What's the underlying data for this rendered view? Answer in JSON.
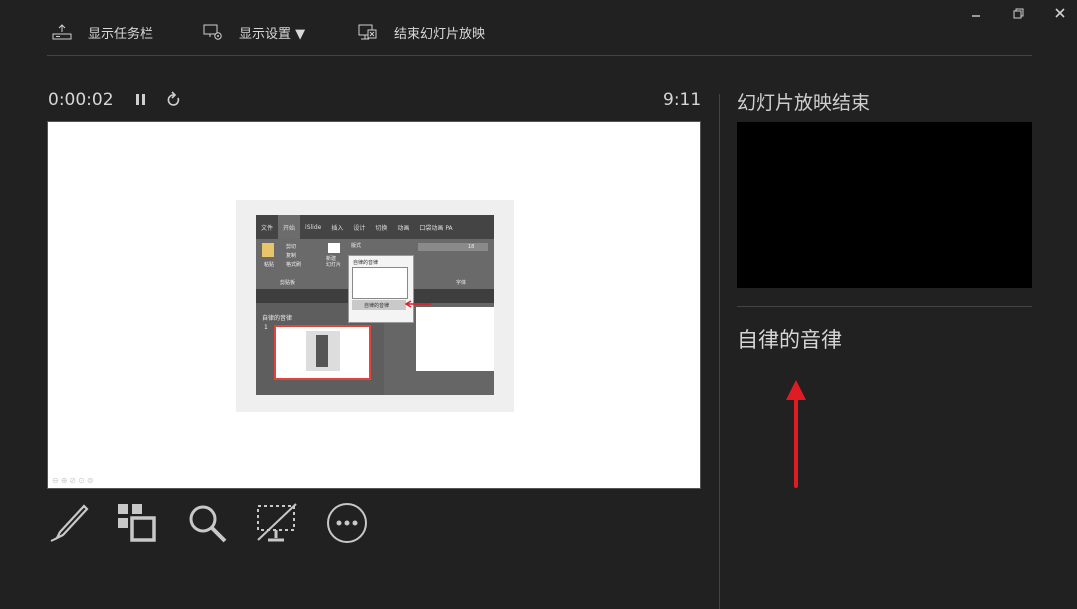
{
  "window": {
    "minimize_icon": "minimize-icon",
    "restore_icon": "restore-icon",
    "close_icon": "close-icon"
  },
  "toolbar": {
    "show_taskbar": "显示任务栏",
    "display_settings": "显示设置 ▼",
    "end_slideshow": "结束幻灯片放映"
  },
  "presenter": {
    "elapsed_time": "0:00:02",
    "clock": "9:11",
    "pause_icon": "pause-icon",
    "restart_icon": "restart-icon"
  },
  "current_slide": {
    "ribbon_tabs": [
      "文件",
      "开始",
      "iSlide",
      "插入",
      "设计",
      "切换",
      "动画",
      "口袋动画 PA"
    ],
    "active_tab_index": 1,
    "ribbon_labels": {
      "paste": "粘贴",
      "cut": "剪切",
      "copy": "复制",
      "format_painter": "格式刷",
      "new_slide": "新建\n幻灯片",
      "layout": "版式",
      "clipboard_group": "剪贴板",
      "font_group": "字体",
      "font_size": "18"
    },
    "section_label": "自律的音律",
    "slide_number": "1",
    "popup_title": "自律的音律",
    "popup_item": "自律的音律"
  },
  "bottom_tools": [
    "pen-icon",
    "see-all-slides-icon",
    "zoom-icon",
    "black-screen-icon",
    "more-options-icon"
  ],
  "next_slide": {
    "title": "幻灯片放映结束"
  },
  "notes": {
    "text": "自律的音律"
  },
  "colors": {
    "background": "#212121",
    "annotation_arrow": "#e01b24",
    "thumb_border": "#e0443a"
  }
}
